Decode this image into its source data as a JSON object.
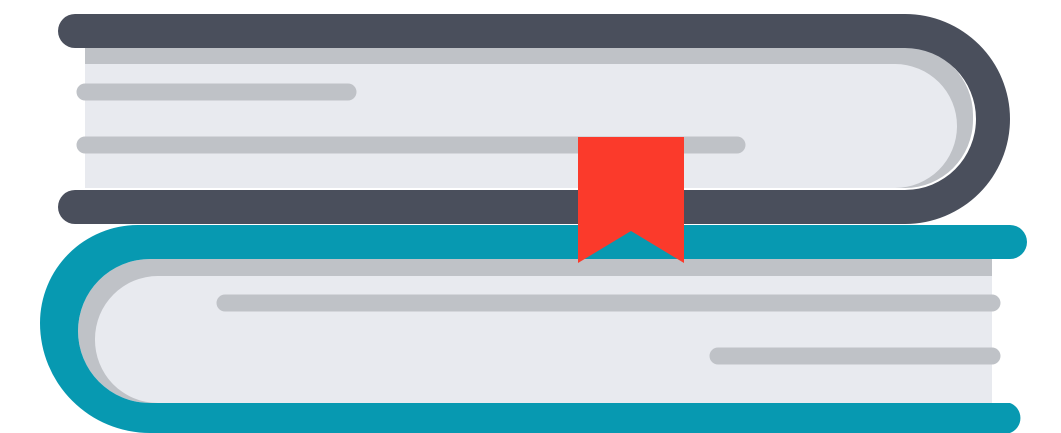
{
  "illustration": {
    "name": "books-stack-icon",
    "colors": {
      "top_cover": "#4a4f5c",
      "bottom_cover": "#0799b1",
      "pages": "#e8eaef",
      "page_shadow": "#bfc2c7",
      "text_lines": "#bfc2c7",
      "bookmark": "#fb3a2b",
      "background": "#ffffff"
    },
    "books": [
      {
        "name": "top-book",
        "icon": "book-icon"
      },
      {
        "name": "bottom-book",
        "icon": "book-icon"
      }
    ],
    "bookmark": {
      "icon": "bookmark-icon"
    }
  }
}
